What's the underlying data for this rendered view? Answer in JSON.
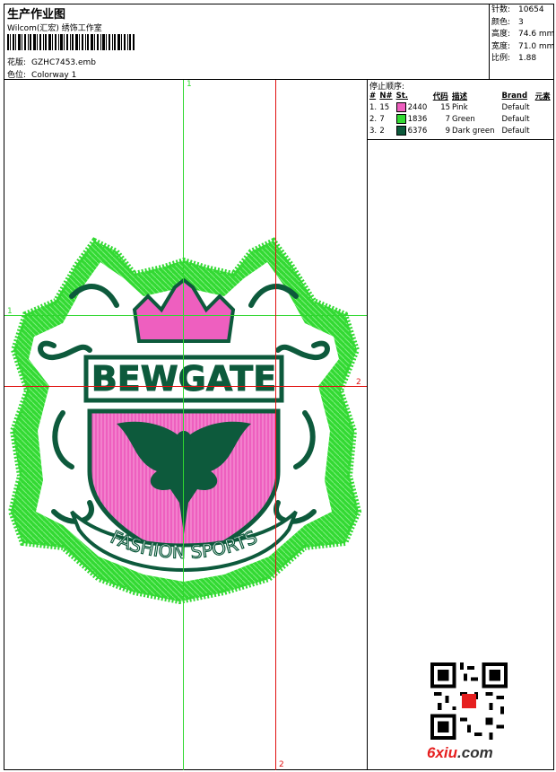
{
  "header": {
    "title": "生产作业图",
    "company": "Wilcom(汇宏) 绣饰工作室",
    "design_label": "花版:",
    "design_value": "GZHC7453.emb",
    "colorway_label": "色位:",
    "colorway_value": "Colorway 1"
  },
  "stats": [
    {
      "label": "针数:",
      "value": "10654"
    },
    {
      "label": "颜色:",
      "value": "3"
    },
    {
      "label": "高度:",
      "value": "74.6 mm"
    },
    {
      "label": "宽度:",
      "value": "71.0 mm"
    },
    {
      "label": "比例:",
      "value": "1.88"
    }
  ],
  "color_table": {
    "title": "停止顺序:",
    "headers": [
      "#",
      "N#",
      "St.",
      "代码",
      "描述",
      "Brand",
      "元素"
    ],
    "rows": [
      {
        "order": "1.",
        "needle": "15",
        "stitches": "2440",
        "code": "15",
        "desc": "Pink",
        "brand": "Default",
        "color": "#ee5fbf"
      },
      {
        "order": "2.",
        "needle": "7",
        "stitches": "1836",
        "code": "7",
        "desc": "Green",
        "brand": "Default",
        "color": "#33d933"
      },
      {
        "order": "3.",
        "needle": "2",
        "stitches": "6376",
        "code": "9",
        "desc": "Dark green",
        "brand": "Default",
        "color": "#0d5a3c"
      }
    ]
  },
  "guides": {
    "green_v": "1",
    "green_h": "1",
    "red_h": "2",
    "red_v": "2"
  },
  "badge": {
    "top_text": "BEWGATE",
    "bottom_text": "FASHION SPORTS"
  },
  "watermark": {
    "brand_red": "6xiu",
    "brand_dark": ".com"
  },
  "colors": {
    "pink": "#ee5fbf",
    "green": "#33d933",
    "dark_green": "#0d5a3c",
    "guide_green": "#2fd82f",
    "guide_red": "#e01010"
  }
}
